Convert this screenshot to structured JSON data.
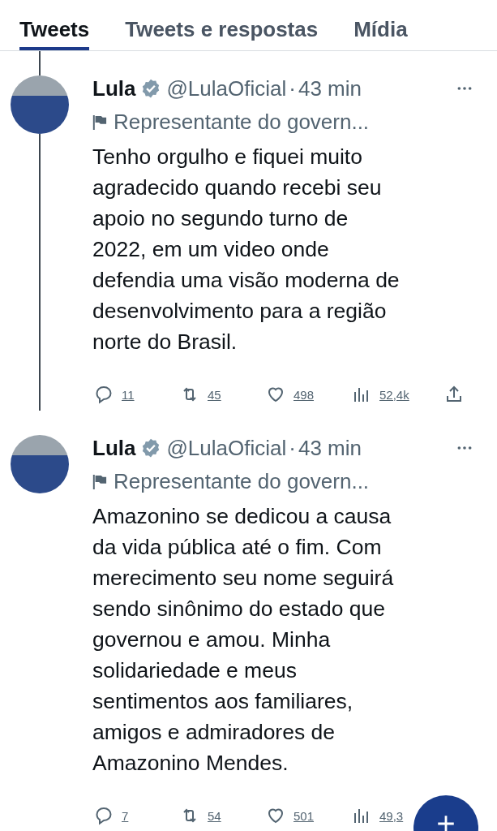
{
  "tabs": [
    {
      "label": "Tweets",
      "selected": true
    },
    {
      "label": "Tweets e respostas",
      "selected": false
    },
    {
      "label": "Mídia",
      "selected": false
    }
  ],
  "tweets": [
    {
      "name": "Lula",
      "handle": "@LulaOficial",
      "separator": "·",
      "time": "43 min",
      "label": "Representante do govern...",
      "body": [
        "Tenho orgulho e fiquei muito",
        "agradecido quando recebi seu",
        "apoio no segundo turno de",
        "2022, em um video onde",
        "defendia uma visão moderna de",
        "desenvolvimento para a região",
        "norte do Brasil."
      ],
      "replies": "11",
      "retweets": "45",
      "likes": "498",
      "views": "52,4k"
    },
    {
      "name": "Lula",
      "handle": "@LulaOficial",
      "separator": "·",
      "time": "43 min",
      "label": "Representante do govern...",
      "body": [
        "Amazonino se dedicou a causa",
        "da vida pública até o fim. Com",
        "merecimento seu nome seguirá",
        "sendo sinônimo do estado que",
        "governou e amou. Minha",
        "solidariedade e meus",
        "sentimentos aos familiares,",
        "amigos e admiradores de",
        "Amazonino Mendes."
      ],
      "replies": "7",
      "retweets": "54",
      "likes": "501",
      "views": "49,3"
    }
  ]
}
